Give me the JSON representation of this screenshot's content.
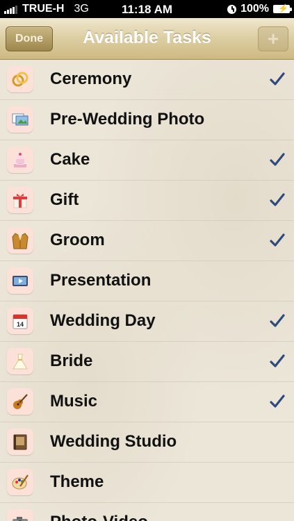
{
  "status_bar": {
    "carrier": "TRUE-H",
    "network": "3G",
    "time": "11:18 AM",
    "battery": "100%"
  },
  "nav": {
    "title": "Available Tasks",
    "done_label": "Done",
    "add_label": "+"
  },
  "colors": {
    "accent": "#2c4a7c",
    "nav_gold": "#cdb982"
  },
  "tasks": [
    {
      "label": "Ceremony",
      "icon": "rings-icon",
      "checked": true
    },
    {
      "label": "Pre-Wedding Photo",
      "icon": "photos-icon",
      "checked": false
    },
    {
      "label": "Cake",
      "icon": "cake-icon",
      "checked": true
    },
    {
      "label": "Gift",
      "icon": "gift-icon",
      "checked": true
    },
    {
      "label": "Groom",
      "icon": "suit-icon",
      "checked": true
    },
    {
      "label": "Presentation",
      "icon": "projector-icon",
      "checked": false
    },
    {
      "label": "Wedding Day",
      "icon": "calendar-icon",
      "checked": true
    },
    {
      "label": "Bride",
      "icon": "dress-icon",
      "checked": true
    },
    {
      "label": "Music",
      "icon": "guitar-icon",
      "checked": true
    },
    {
      "label": "Wedding Studio",
      "icon": "album-icon",
      "checked": false
    },
    {
      "label": "Theme",
      "icon": "palette-icon",
      "checked": false
    },
    {
      "label": "Photo-Video",
      "icon": "camera-icon",
      "checked": false
    }
  ]
}
